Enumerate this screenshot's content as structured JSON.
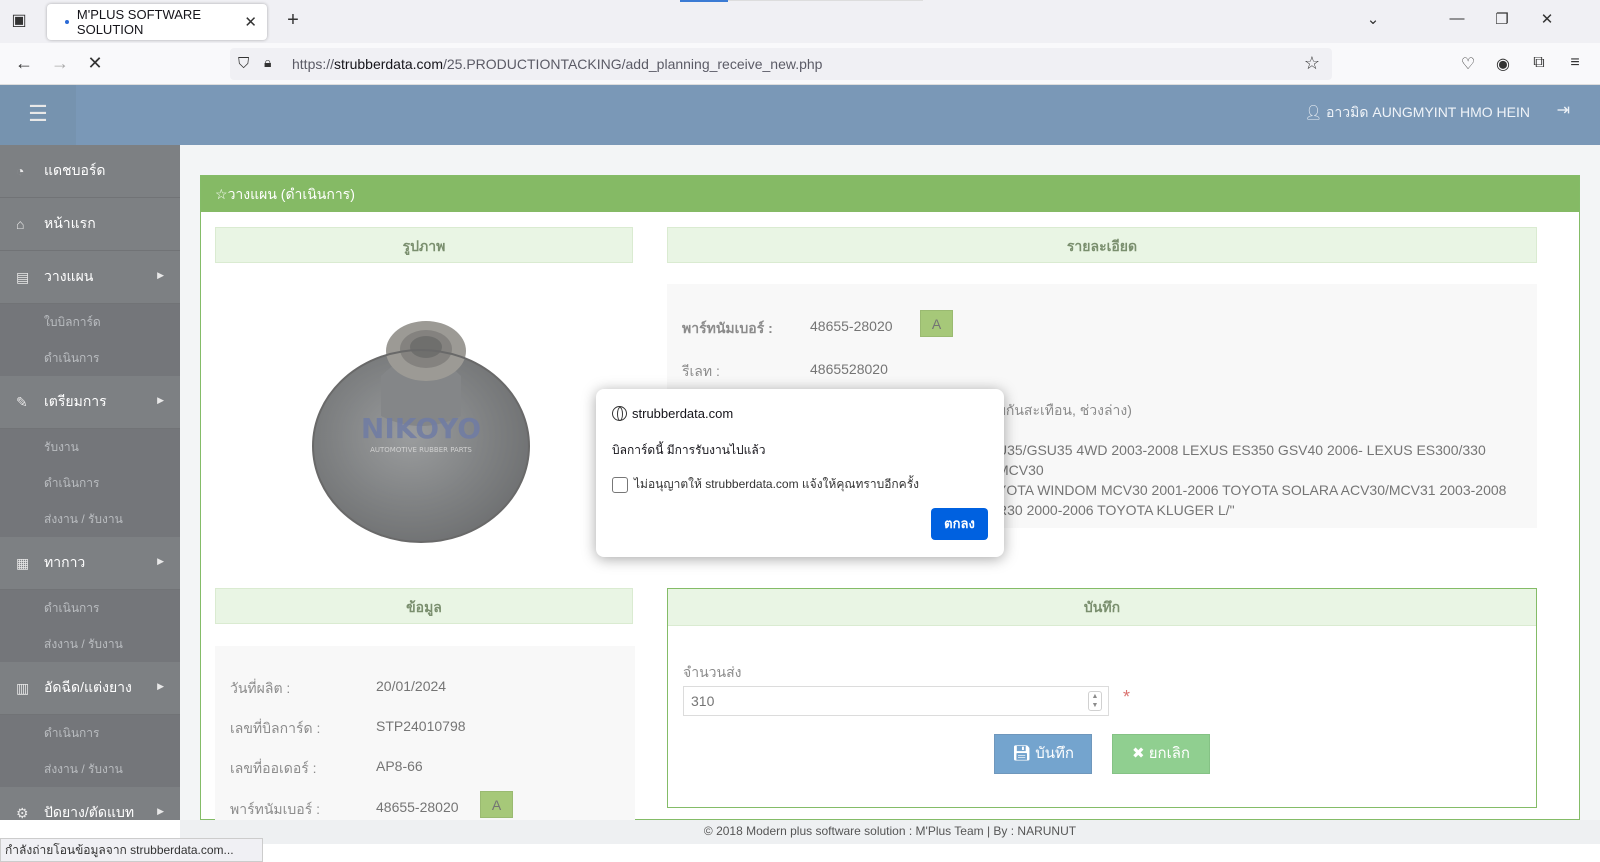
{
  "browser": {
    "tab_title": "M'PLUS SOFTWARE SOLUTION",
    "url_prefix": "https://",
    "url_domain": "strubberdata.com",
    "url_path": "/25.PRODUCTIONTACKING/add_planning_receive_new.php",
    "status_text": "กำลังถ่ายโอนข้อมูลจาก strubberdata.com..."
  },
  "header": {
    "user_label": "อาวมิด AUNGMYINT HMO HEIN"
  },
  "sidebar": {
    "items": [
      {
        "label": "แดชบอร์ด",
        "icon": "dashboard-icon",
        "type": "main"
      },
      {
        "label": "หน้าแรก",
        "icon": "home-icon",
        "type": "main"
      },
      {
        "label": "วางแผน",
        "icon": "file-icon",
        "type": "main",
        "has_arrow": true
      },
      {
        "label": "ใบบิลการ์ด",
        "type": "sub"
      },
      {
        "label": "ดำเนินการ",
        "type": "sub"
      },
      {
        "label": "เตรียมการ",
        "icon": "magic-wand-icon",
        "type": "main",
        "has_arrow": true
      },
      {
        "label": "รับงาน",
        "type": "sub"
      },
      {
        "label": "ดำเนินการ",
        "type": "sub"
      },
      {
        "label": "ส่งงาน / รับงาน",
        "type": "sub"
      },
      {
        "label": "ทากาว",
        "icon": "document-icon",
        "type": "main",
        "has_arrow": true
      },
      {
        "label": "ดำเนินการ",
        "type": "sub"
      },
      {
        "label": "ส่งงาน / รับงาน",
        "type": "sub"
      },
      {
        "label": "อัดฉีด/แต่งยาง",
        "icon": "building-icon",
        "type": "main",
        "has_arrow": true
      },
      {
        "label": "ดำเนินการ",
        "type": "sub"
      },
      {
        "label": "ส่งงาน / รับงาน",
        "type": "sub"
      },
      {
        "label": "ปัดยาง/ตัดแบท",
        "icon": "gear-icon",
        "type": "main",
        "has_arrow": true
      }
    ]
  },
  "panel": {
    "title": "วางแผน (ดำเนินการ)",
    "image_section": "รูปภาพ",
    "image_brand": "NIKOYO",
    "image_tagline": "AUTOMOTIVE RUBBER PARTS",
    "detail_section": "รายละเอียด",
    "part_number_label": "พาร์ทนัมเบอร์ :",
    "part_number": "48655-28020",
    "grade": "A",
    "relate_label": "รีเลท :",
    "relate": "4865528020",
    "name_fragment": "บกันสะเทือน, ช่วงล่าง)",
    "description_lines": [
      "U35/GSU35 4WD 2003-2008 LEXUS ES350 GSV40 2006- LEXUS ES300/330 MCV30",
      "YOTA WINDOM MCV30 2001-2006 TOYOTA SOLARA ACV30/MCV31 2003-2008",
      "R30 2000-2006 TOYOTA KLUGER L/\""
    ],
    "info_section": "ข้อมูล",
    "info_rows": [
      {
        "label": "วันที่ผลิต :",
        "value": "20/01/2024"
      },
      {
        "label": "เลขที่บิลการ์ด :",
        "value": "STP24010798"
      },
      {
        "label": "เลขที่ออเดอร์ :",
        "value": "AP8-66"
      },
      {
        "label": "พาร์ทนัมเบอร์ :",
        "value": "48655-28020"
      }
    ],
    "info_grade": "A",
    "save_section": "บันทึก",
    "qty_label": "จำนวนส่ง",
    "qty_value": "310",
    "required_mark": "*",
    "save_button": "บันทึก",
    "cancel_button": "ยกเลิก"
  },
  "footer": {
    "text": "© 2018 Modern plus software solution : M'Plus Team | By : NARUNUT"
  },
  "dialog": {
    "origin": "strubberdata.com",
    "message": "บิลการ์ดนี้ มีการรับงานไปแล้ว",
    "checkbox_label": "ไม่อนุญาตให้ strubberdata.com แจ้งให้คุณทราบอีกครั้ง",
    "ok_button": "ตกลง"
  }
}
